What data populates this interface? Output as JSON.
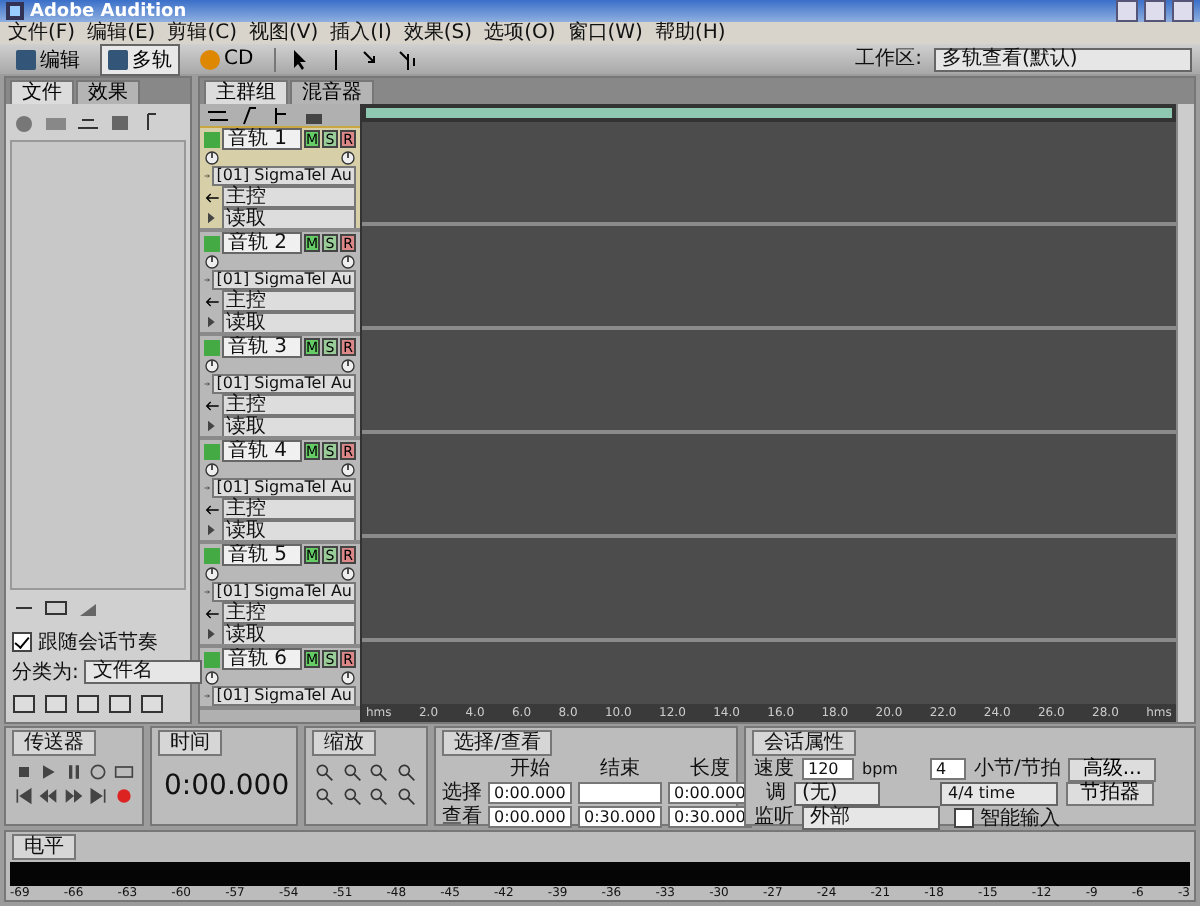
{
  "window": {
    "title": "Adobe Audition"
  },
  "menu": [
    "文件(F)",
    "编辑(E)",
    "剪辑(C)",
    "视图(V)",
    "插入(I)",
    "效果(S)",
    "选项(O)",
    "窗口(W)",
    "帮助(H)"
  ],
  "toolbar": {
    "modes": [
      {
        "label": "编辑",
        "selected": false
      },
      {
        "label": "多轨",
        "selected": true
      },
      {
        "label": "CD",
        "selected": false
      }
    ],
    "workspace_label": "工作区:",
    "workspace": "多轨查看(默认)"
  },
  "files_panel": {
    "tabs": [
      {
        "label": "文件",
        "selected": true
      },
      {
        "label": "效果",
        "selected": false
      }
    ],
    "follow_tempo": {
      "label": "跟随会话节奏",
      "checked": true
    },
    "sort_label": "分类为:",
    "sort_value": "文件名"
  },
  "main": {
    "tabs": [
      {
        "label": "主群组",
        "selected": true
      },
      {
        "label": "混音器",
        "selected": false
      }
    ],
    "tracks": [
      {
        "name": "音轨 1",
        "selected": true,
        "buttons": [
          "M",
          "S",
          "R"
        ],
        "input": "[01] SigmaTel Au",
        "output": "主控",
        "automation": "读取"
      },
      {
        "name": "音轨 2",
        "selected": false,
        "buttons": [
          "M",
          "S",
          "R"
        ],
        "input": "[01] SigmaTel Au",
        "output": "主控",
        "automation": "读取"
      },
      {
        "name": "音轨 3",
        "selected": false,
        "buttons": [
          "M",
          "S",
          "R"
        ],
        "input": "[01] SigmaTel Au",
        "output": "主控",
        "automation": "读取"
      },
      {
        "name": "音轨 4",
        "selected": false,
        "buttons": [
          "M",
          "S",
          "R"
        ],
        "input": "[01] SigmaTel Au",
        "output": "主控",
        "automation": "读取"
      },
      {
        "name": "音轨 5",
        "selected": false,
        "buttons": [
          "M",
          "S",
          "R"
        ],
        "input": "[01] SigmaTel Au",
        "output": "主控",
        "automation": "读取"
      },
      {
        "name": "音轨 6",
        "selected": false,
        "buttons": [
          "M",
          "S",
          "R"
        ],
        "input": "[01] SigmaTel Au"
      }
    ],
    "ruler": [
      "hms",
      "2.0",
      "4.0",
      "6.0",
      "8.0",
      "10.0",
      "12.0",
      "14.0",
      "16.0",
      "18.0",
      "20.0",
      "22.0",
      "24.0",
      "26.0",
      "28.0",
      "hms"
    ]
  },
  "transport": {
    "title": "传送器"
  },
  "time": {
    "title": "时间",
    "value": "0:00.000"
  },
  "zoom": {
    "title": "缩放"
  },
  "selection": {
    "title": "选择/查看",
    "columns": [
      "开始",
      "结束",
      "长度"
    ],
    "rows": [
      {
        "label": "选择",
        "start": "0:00.000",
        "length": "0:00.000"
      },
      {
        "label": "查看",
        "start": "0:00.000",
        "end": "0:30.000",
        "length": "0:30.000"
      }
    ]
  },
  "session": {
    "title": "会话属性",
    "tempo_label": "速度",
    "tempo": "120",
    "tempo_unit": "bpm",
    "beats": "4",
    "beats_label": "小节/节拍",
    "advanced": "高级...",
    "key_label": "调",
    "key": "(无)",
    "time_signature": "4/4 time",
    "metronome": "节拍器",
    "monitor_label": "监听",
    "monitor": "外部",
    "smart_input": {
      "label": "智能输入",
      "checked": false
    }
  },
  "level": {
    "title": "电平",
    "scale": [
      "-69",
      "-66",
      "-63",
      "-60",
      "-57",
      "-54",
      "-51",
      "-48",
      "-45",
      "-42",
      "-39",
      "-36",
      "-33",
      "-30",
      "-27",
      "-24",
      "-21",
      "-18",
      "-15",
      "-12",
      "-9",
      "-6",
      "-3"
    ]
  }
}
